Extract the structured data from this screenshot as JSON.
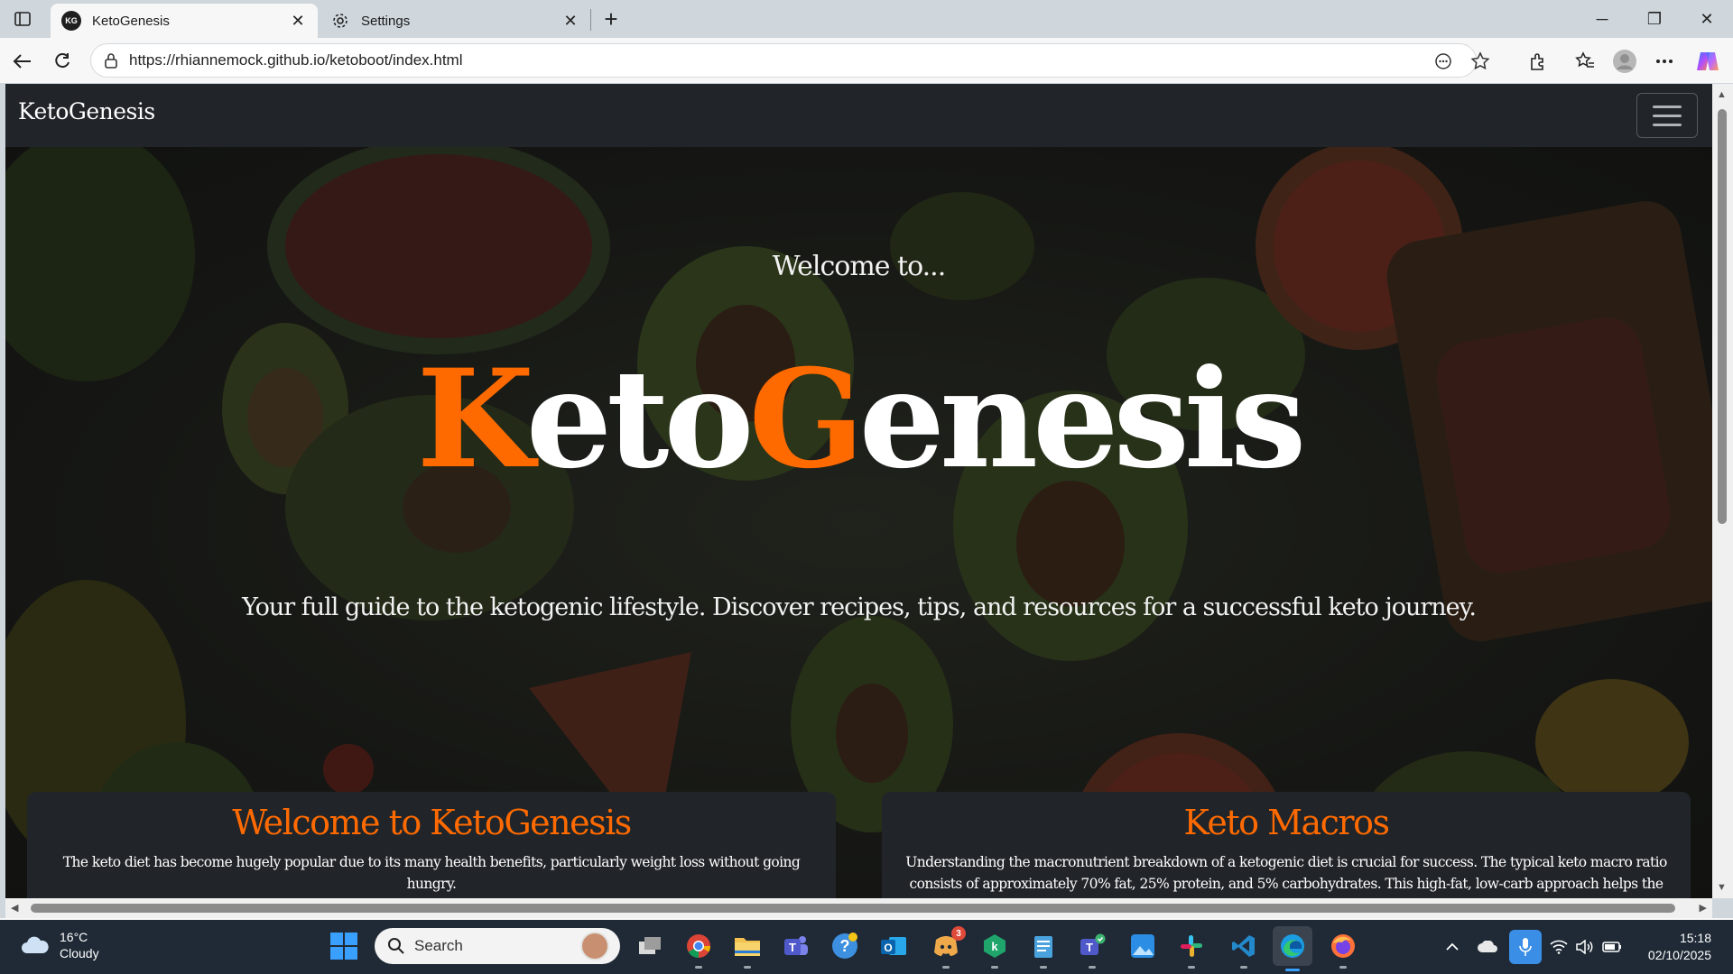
{
  "browser": {
    "tabs": [
      {
        "label": "KetoGenesis",
        "favicon_text": "KG",
        "active": true
      },
      {
        "label": "Settings",
        "active": false
      }
    ],
    "url": "https://rhiannemock.github.io/ketoboot/index.html",
    "new_tab_symbol": "+",
    "close_symbol": "✕",
    "window_controls": {
      "minimize": "─",
      "maximize": "❐",
      "close": "✕"
    },
    "icons": [
      "sidebar-toggle-icon",
      "back-icon",
      "refresh-icon",
      "site-info-icon",
      "read-aloud-icon",
      "favorite-star-icon",
      "extensions-icon",
      "favorites-icon",
      "profile-icon",
      "more-icon",
      "copilot-icon"
    ]
  },
  "site": {
    "brand": "KetoGenesis",
    "hero": {
      "welcome": "Welcome to...",
      "title_part1_accent": "K",
      "title_part2": "eto",
      "title_part3_accent": "G",
      "title_part4": "enesis",
      "tagline": "Your full guide to the ketogenic lifestyle. Discover recipes, tips, and resources for a successful keto journey."
    },
    "cards": [
      {
        "heading": "Welcome to KetoGenesis",
        "text": "The keto diet has become hugely popular due to its many health benefits, particularly weight loss without going hungry."
      },
      {
        "heading": "Keto Macros",
        "text": "Understanding the macronutrient breakdown of a ketogenic diet is crucial for success. The typical keto macro ratio consists of approximately 70% fat, 25% protein, and 5% carbohydrates. This high-fat, low-carb approach helps the body enter and maintain"
      }
    ],
    "colors": {
      "accent": "#ff6a00",
      "navbar": "#212529",
      "card": "#212529"
    }
  },
  "taskbar": {
    "weather_temp": "16°C",
    "weather_desc": "Cloudy",
    "search_placeholder": "Search",
    "clock_time": "15:18",
    "clock_date": "02/10/2025",
    "discord_badge": "3",
    "apps": [
      "task-view",
      "chrome",
      "file-explorer",
      "teams",
      "help",
      "outlook",
      "discord",
      "kaspersky",
      "notepad",
      "teams-work",
      "photos",
      "slack",
      "vscode",
      "edge",
      "firefox"
    ]
  }
}
